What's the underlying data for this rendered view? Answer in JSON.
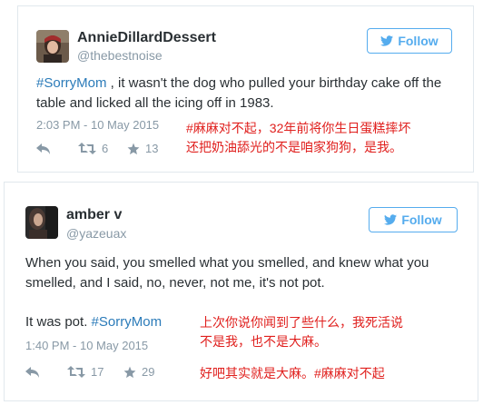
{
  "colors": {
    "link": "#2b7bb9",
    "follow": "#55acee",
    "muted": "#8899a6",
    "annotation": "#e0201e"
  },
  "tweets": [
    {
      "display_name": "AnnieDillardDessert",
      "handle": "@thebestnoise",
      "follow_label": "Follow",
      "hashtag": "#SorryMom",
      "text": " , it wasn't the dog who pulled your birthday cake off the table and licked all the icing off in 1983.",
      "timestamp": "2:03 PM - 10 May 2015",
      "retweets": "6",
      "likes": "13",
      "annotation_lines": [
        "#麻麻对不起，32年前将你生日蛋糕摔坏",
        "还把奶油舔光的不是咱家狗狗，是我。"
      ]
    },
    {
      "display_name": "amber v",
      "handle": "@yazeuax",
      "follow_label": "Follow",
      "text_line1": "When you said, you smelled what you smelled, and knew what you smelled, and I said, no, never, not me, it's not pot.",
      "text_line2_prefix": "It was pot. ",
      "hashtag": "#SorryMom",
      "timestamp": "1:40 PM - 10 May 2015",
      "retweets": "17",
      "likes": "29",
      "annotation_lines": [
        "上次你说你闻到了些什么，我死活说",
        "不是我，也不是大麻。",
        "好吧其实就是大麻。#麻麻对不起"
      ]
    }
  ]
}
